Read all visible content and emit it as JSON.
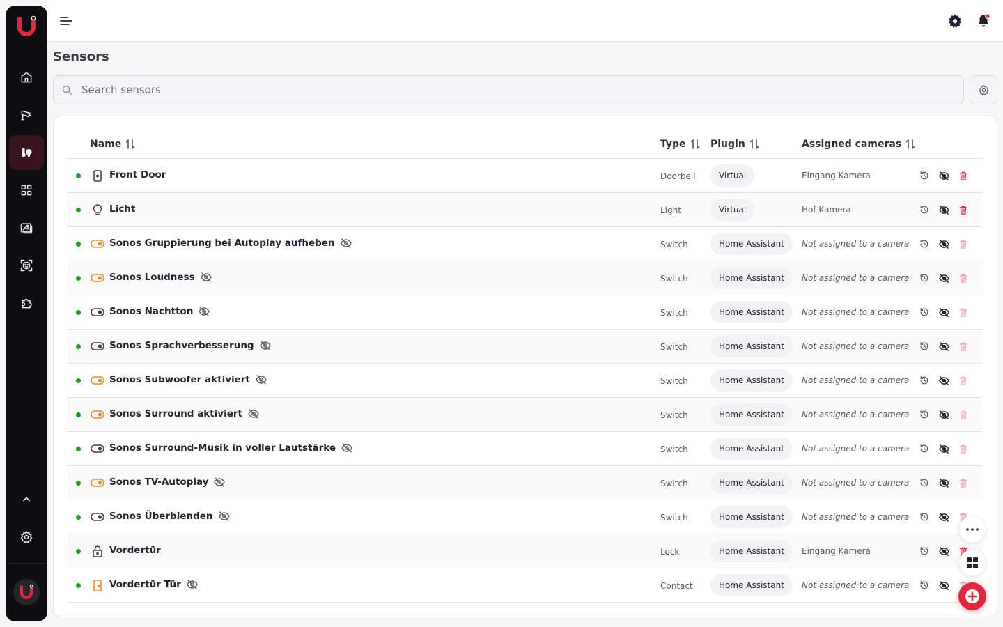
{
  "page": {
    "title": "Sensors"
  },
  "search": {
    "placeholder": "Search sensors"
  },
  "columns": {
    "name": "Name",
    "type": "Type",
    "plugin": "Plugin",
    "cameras": "Assigned cameras"
  },
  "colors": {
    "accent": "#e2263d",
    "status_online": "#10a01c",
    "switch_on": "#f08a24"
  },
  "sidebar": {
    "items": [
      {
        "icon": "home-icon"
      },
      {
        "icon": "camera-icon"
      },
      {
        "icon": "sensors-icon",
        "active": true
      },
      {
        "icon": "dashboard-icon"
      },
      {
        "icon": "gallery-icon"
      },
      {
        "icon": "face-recognition-icon"
      },
      {
        "icon": "plugins-icon"
      }
    ]
  },
  "rows": [
    {
      "name": "Front Door",
      "icon": "doorbell-icon",
      "hidden": false,
      "type": "Doorbell",
      "plugin": "Virtual",
      "cameras": "Eingang Kamera",
      "assigned": true
    },
    {
      "name": "Licht",
      "icon": "lightbulb-icon",
      "hidden": false,
      "type": "Light",
      "plugin": "Virtual",
      "cameras": "Hof Kamera",
      "assigned": true
    },
    {
      "name": "Sonos Gruppierung bei Autoplay aufheben",
      "icon": "switch-on-icon",
      "hidden": true,
      "type": "Switch",
      "plugin": "Home Assistant",
      "cameras": "Not assigned to a camera",
      "assigned": false
    },
    {
      "name": "Sonos Loudness",
      "icon": "switch-on-icon",
      "hidden": true,
      "type": "Switch",
      "plugin": "Home Assistant",
      "cameras": "Not assigned to a camera",
      "assigned": false
    },
    {
      "name": "Sonos Nachtton",
      "icon": "switch-off-icon",
      "hidden": true,
      "type": "Switch",
      "plugin": "Home Assistant",
      "cameras": "Not assigned to a camera",
      "assigned": false
    },
    {
      "name": "Sonos Sprachverbesserung",
      "icon": "switch-off-icon",
      "hidden": true,
      "type": "Switch",
      "plugin": "Home Assistant",
      "cameras": "Not assigned to a camera",
      "assigned": false
    },
    {
      "name": "Sonos Subwoofer aktiviert",
      "icon": "switch-on-icon",
      "hidden": true,
      "type": "Switch",
      "plugin": "Home Assistant",
      "cameras": "Not assigned to a camera",
      "assigned": false
    },
    {
      "name": "Sonos Surround aktiviert",
      "icon": "switch-on-icon",
      "hidden": true,
      "type": "Switch",
      "plugin": "Home Assistant",
      "cameras": "Not assigned to a camera",
      "assigned": false
    },
    {
      "name": "Sonos Surround-Musik in voller Lautstärke",
      "icon": "switch-off-icon",
      "hidden": true,
      "type": "Switch",
      "plugin": "Home Assistant",
      "cameras": "Not assigned to a camera",
      "assigned": false
    },
    {
      "name": "Sonos TV-Autoplay",
      "icon": "switch-on-icon",
      "hidden": true,
      "type": "Switch",
      "plugin": "Home Assistant",
      "cameras": "Not assigned to a camera",
      "assigned": false
    },
    {
      "name": "Sonos Überblenden",
      "icon": "switch-off-icon",
      "hidden": true,
      "type": "Switch",
      "plugin": "Home Assistant",
      "cameras": "Not assigned to a camera",
      "assigned": false
    },
    {
      "name": "Vordertür",
      "icon": "lock-icon",
      "hidden": false,
      "type": "Lock",
      "plugin": "Home Assistant",
      "cameras": "Eingang Kamera",
      "assigned": true
    },
    {
      "name": "Vordertür Tür",
      "icon": "contact-door-icon",
      "hidden": true,
      "type": "Contact",
      "plugin": "Home Assistant",
      "cameras": "Not assigned to a camera",
      "assigned": false
    }
  ]
}
